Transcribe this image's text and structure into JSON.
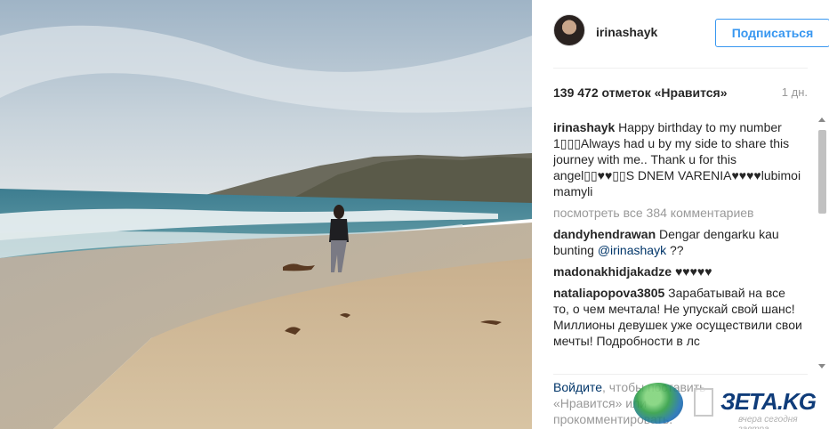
{
  "post": {
    "username": "irinashayk",
    "follow_label": "Подписаться",
    "likes_text": "139 472 отметок «Нравится»",
    "time_ago": "1 дн."
  },
  "caption": {
    "user": "irinashayk",
    "text": "Happy birthday to my number 1▯▯▯Always had u by my side to share this journey with me.. Thank u for this angel▯▯♥♥▯▯S DNEM VARENIA♥♥♥♥lubimoi mamyli"
  },
  "view_all_text": "посмотреть все 384 комментариев",
  "comments": [
    {
      "user": "dandyhendrawan",
      "text": "Dengar dengarku kau bunting ",
      "mention": "@irinashayk",
      "after": " ??"
    },
    {
      "user": "madonakhidjakadze",
      "text": "♥♥♥♥♥",
      "mention": "",
      "after": ""
    },
    {
      "user": "nataliapopova3805",
      "text": "Зарабатывай на все то, о чем мечтала! Не упускай свой шанс! Миллионы девушек уже осуществили свои мечты! Подробности в лс",
      "mention": "",
      "after": ""
    }
  ],
  "login_note": {
    "link_login": "Войдите",
    "part1": ", чтобы поставить «Нравится» или",
    "part2": "прокомментировать."
  },
  "watermark": {
    "title": "ЗЕТА.KG",
    "subtitle": "вчера сегодня завтра"
  },
  "icons": [
    "avatar",
    "scroll-up-arrow",
    "scroll-down-arrow",
    "watermark-globe"
  ]
}
